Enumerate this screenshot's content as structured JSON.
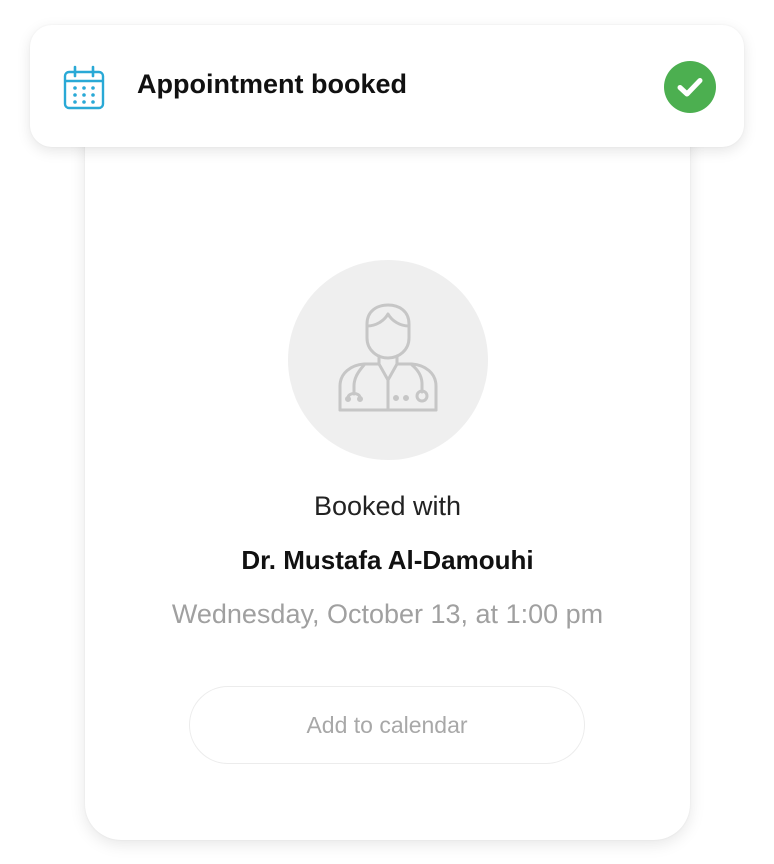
{
  "notification": {
    "icon": "calendar-icon",
    "title": "Appointment booked",
    "status_icon": "check-circle-icon",
    "status_color": "#4caf50",
    "icon_color": "#29a9d6"
  },
  "booking": {
    "avatar_icon": "doctor-icon",
    "booked_with_label": "Booked with",
    "doctor_name": "Dr. Mustafa Al-Damouhi",
    "date_time": "Wednesday, October 13, at 1:00 pm",
    "add_to_calendar_label": "Add to calendar"
  }
}
